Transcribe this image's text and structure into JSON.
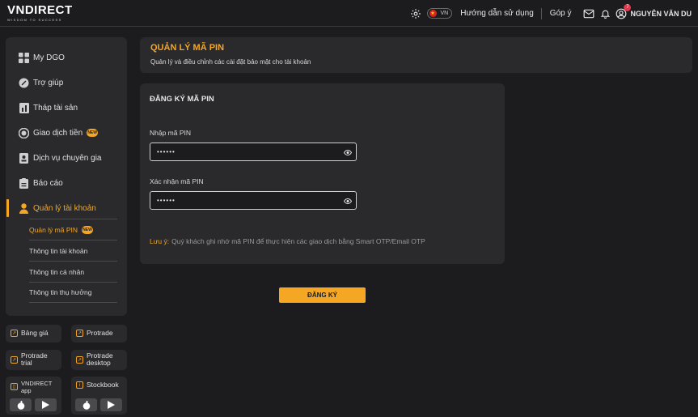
{
  "header": {
    "logo": "VNDIRECT",
    "logo_tagline": "WISDOM TO SUCCESS",
    "language": "VN",
    "help_link": "Hướng dẫn sử dụng",
    "feedback_link": "Góp ý",
    "notification_count": "7",
    "user_name": "NGUYỄN VĂN DU"
  },
  "sidebar": {
    "items": [
      {
        "label": "My DGO",
        "icon": "grid-icon"
      },
      {
        "label": "Trợ giúp",
        "icon": "help-icon"
      },
      {
        "label": "Tháp tài sản",
        "icon": "asset-icon"
      },
      {
        "label": "Giao dịch tiền",
        "icon": "money-icon",
        "badge": "NEW"
      },
      {
        "label": "Dịch vụ chuyên gia",
        "icon": "expert-icon"
      },
      {
        "label": "Báo cáo",
        "icon": "report-icon"
      },
      {
        "label": "Quản lý tài khoản",
        "icon": "user-icon"
      }
    ],
    "sub_items": [
      {
        "label": "Quản lý mã PIN",
        "badge": "NEW"
      },
      {
        "label": "Thông tin tài khoản"
      },
      {
        "label": "Thông tin cá nhân"
      },
      {
        "label": "Thông tin thụ hưởng"
      }
    ]
  },
  "tiles": {
    "bang_gia": "Bảng giá",
    "protrade": "Protrade",
    "protrade_trial": "Protrade trial",
    "protrade_desktop": "Protrade desktop",
    "vndirect_app": "VNDIRECT app",
    "stockbook": "Stockbook"
  },
  "page": {
    "title": "QUẢN LÝ MÃ PIN",
    "subtitle": "Quản lý và điều chỉnh các cài đặt bảo mật cho tài khoản"
  },
  "form": {
    "title": "ĐĂNG KÝ MÃ PIN",
    "pin_label": "Nhập mã PIN",
    "pin_value": "••••••",
    "confirm_label": "Xác nhận mã PIN",
    "confirm_value": "••••••",
    "note_key": "Lưu ý:",
    "note_text": "Quý khách ghi nhớ mã PIN để thực hiện các giao dịch bằng Smart OTP/Email OTP",
    "submit_label": "ĐĂNG KÝ"
  },
  "colors": {
    "accent": "#f5a623",
    "background": "#1c1c1e",
    "panel": "#2a2a2c"
  }
}
